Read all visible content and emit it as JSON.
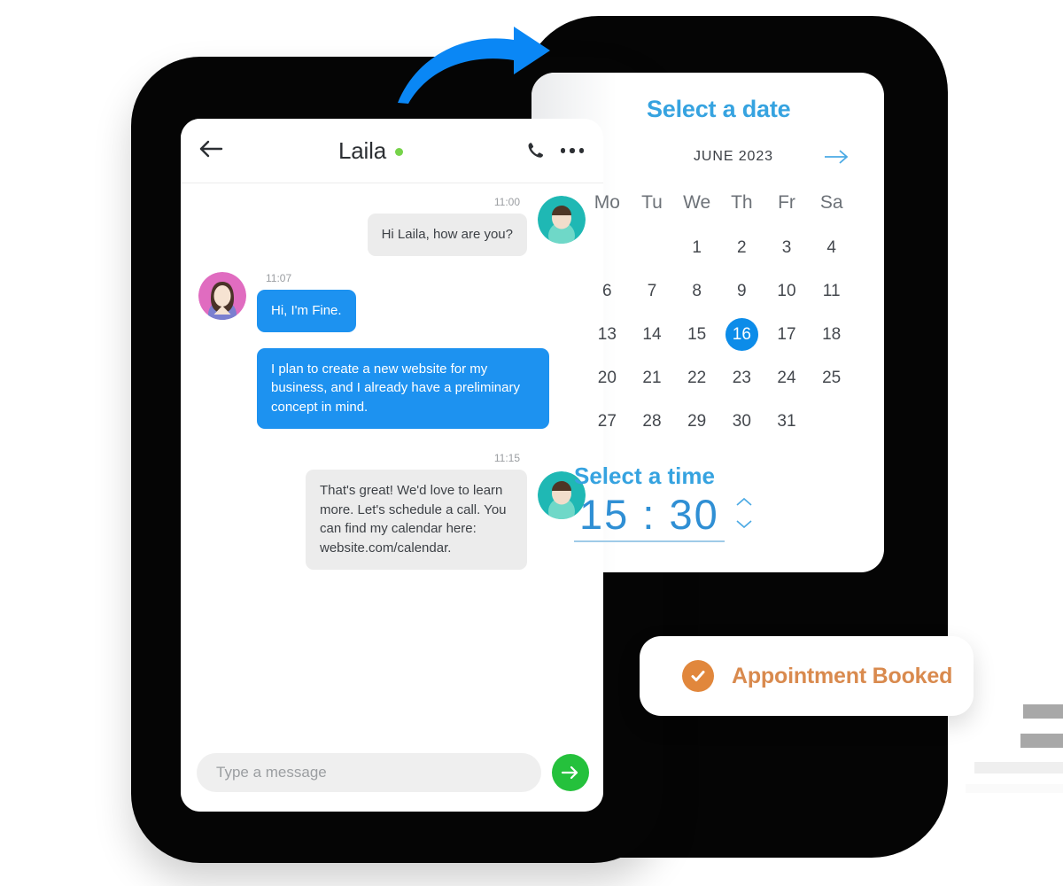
{
  "chat": {
    "header": {
      "back_icon": "arrow-left-icon",
      "contact_name": "Laila",
      "online_status": "online",
      "call_icon": "phone-icon",
      "more_icon": "more-dots-icon"
    },
    "messages": [
      {
        "time": "11:00",
        "text": "Hi Laila, how are you?",
        "side": "out",
        "style": "gray",
        "avatar": "teal-user-avatar"
      },
      {
        "time": "11:07",
        "text": "Hi, I'm Fine.",
        "side": "in",
        "style": "blue",
        "avatar": "pink-user-avatar"
      },
      {
        "time": "",
        "text": "I plan to create a new website for my business, and I already have a preliminary concept in mind.",
        "side": "in",
        "style": "blue",
        "avatar": ""
      },
      {
        "time": "11:15",
        "text": "That's great! We'd love to learn more. Let's schedule a call. You can find my calendar here: website.com/calendar.",
        "side": "out",
        "style": "gray",
        "avatar": "teal-user-avatar"
      }
    ],
    "footer": {
      "input_placeholder": "Type a message",
      "input_value": "",
      "send_icon": "arrow-right-icon"
    }
  },
  "scheduler": {
    "date_title": "Select a date",
    "month_label": "JUNE 2023",
    "next_month_icon": "arrow-right-icon",
    "day_headers": [
      "Mo",
      "Tu",
      "We",
      "Th",
      "Fr",
      "Sa"
    ],
    "weeks": [
      [
        "",
        "",
        "1",
        "2",
        "3",
        "4"
      ],
      [
        "6",
        "7",
        "8",
        "9",
        "10",
        "11"
      ],
      [
        "13",
        "14",
        "15",
        "16",
        "17",
        "18"
      ],
      [
        "20",
        "21",
        "22",
        "23",
        "24",
        "25"
      ],
      [
        "27",
        "28",
        "29",
        "30",
        "31",
        ""
      ]
    ],
    "selected_day": "16",
    "time_title": "Select a time",
    "time_hours": "15",
    "time_separator": ":",
    "time_minutes": "30",
    "spinner_up_icon": "chevron-up-icon",
    "spinner_down_icon": "chevron-down-icon"
  },
  "notification": {
    "check_icon": "check-circle-icon",
    "label": "Appointment Booked"
  },
  "decor": {
    "flow_arrow_icon": "curved-arrow-icon"
  },
  "colors": {
    "accent_blue": "#1d92f0",
    "calendar_blue": "#36a3e0",
    "selected_day_blue": "#0c8ce9",
    "send_green": "#25c13c",
    "status_green": "#76d34a",
    "booked_orange": "#d98a4e",
    "bubble_gray": "#ececec",
    "frame_black": "#050505"
  }
}
